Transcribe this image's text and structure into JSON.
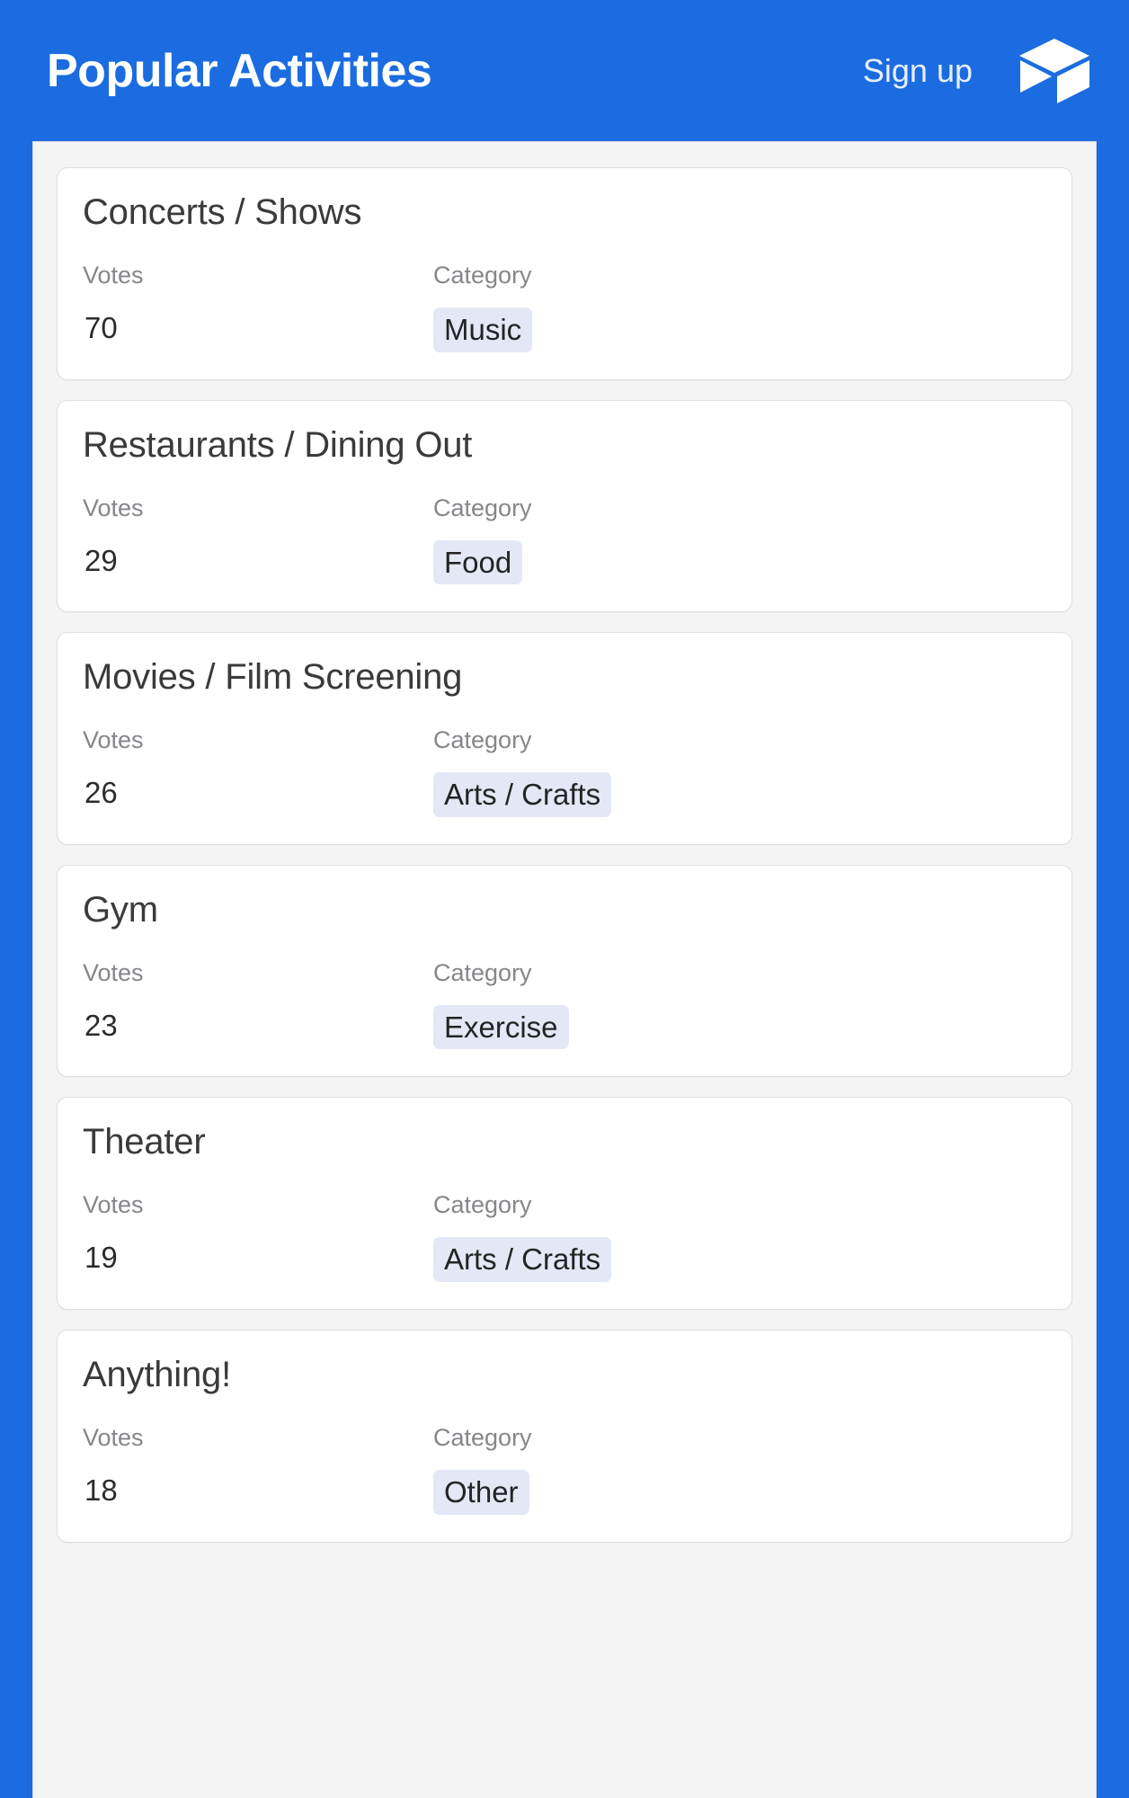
{
  "header": {
    "title": "Popular Activities",
    "signup_label": "Sign up",
    "logo_icon": "cube-play-logo-icon",
    "background_color": "#1B6CE0",
    "text_color": "#FFFFFF"
  },
  "colors": {
    "accent": "#1B6CE0",
    "panel_background": "#F4F4F5",
    "card_background": "#FFFFFF",
    "card_border": "#DEDEE1",
    "badge_background": "#E4E7F6",
    "label_text": "#86868B",
    "value_text": "#2C2C2E"
  },
  "list": {
    "labels": {
      "votes": "Votes",
      "category": "Category"
    },
    "items": [
      {
        "title": "Concerts / Shows",
        "votes_label": "Votes",
        "votes": "70",
        "category_label": "Category",
        "category": "Music"
      },
      {
        "title": "Restaurants / Dining Out",
        "votes_label": "Votes",
        "votes": "29",
        "category_label": "Category",
        "category": "Food"
      },
      {
        "title": "Movies / Film Screening",
        "votes_label": "Votes",
        "votes": "26",
        "category_label": "Category",
        "category": "Arts / Crafts"
      },
      {
        "title": "Gym",
        "votes_label": "Votes",
        "votes": "23",
        "category_label": "Category",
        "category": "Exercise"
      },
      {
        "title": "Theater",
        "votes_label": "Votes",
        "votes": "19",
        "category_label": "Category",
        "category": "Arts / Crafts"
      },
      {
        "title": "Anything!",
        "votes_label": "Votes",
        "votes": "18",
        "category_label": "Category",
        "category": "Other"
      }
    ]
  }
}
